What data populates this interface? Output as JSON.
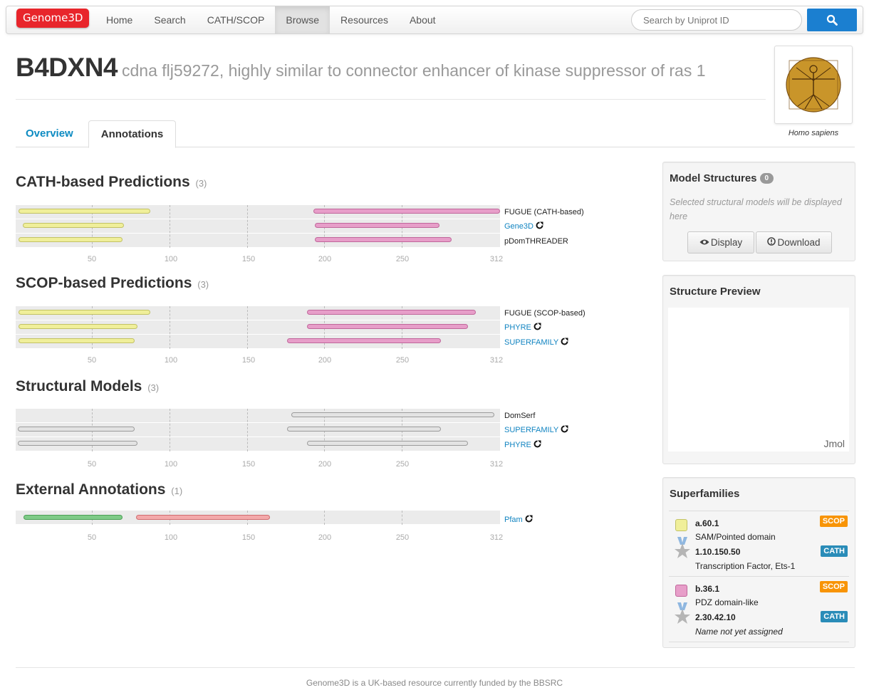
{
  "nav": {
    "brand": "Genome3D",
    "items": [
      "Home",
      "Search",
      "CATH/SCOP",
      "Browse",
      "Resources",
      "About"
    ],
    "active": "Browse",
    "search_placeholder": "Search by Uniprot ID"
  },
  "header": {
    "accession": "B4DXN4",
    "description": "cdna flj59272, highly similar to connector enhancer of kinase suppressor of ras 1",
    "species": "Homo sapiens"
  },
  "tabs": [
    "Overview",
    "Annotations"
  ],
  "axis_ticks": [
    "50",
    "100",
    "150",
    "200",
    "250",
    "312"
  ],
  "sections": {
    "cath": {
      "title": "CATH-based Predictions",
      "count": "(3)",
      "methods": [
        "FUGUE (CATH-based)",
        "Gene3D",
        "pDomTHREADER"
      ]
    },
    "scop": {
      "title": "SCOP-based Predictions",
      "count": "(3)",
      "methods": [
        "FUGUE (SCOP-based)",
        "PHYRE",
        "SUPERFAMILY"
      ]
    },
    "models": {
      "title": "Structural Models",
      "count": "(3)",
      "methods": [
        "DomSerf",
        "SUPERFAMILY",
        "PHYRE"
      ]
    },
    "external": {
      "title": "External Annotations",
      "count": "(1)",
      "methods": [
        "Pfam"
      ]
    }
  },
  "sidebar": {
    "model_structures": {
      "title": "Model Structures",
      "count": "0",
      "help": "Selected structural models will be displayed here",
      "display_label": "Display",
      "download_label": "Download"
    },
    "preview": {
      "title": "Structure Preview",
      "viewer": "Jmol"
    },
    "superfamilies": {
      "title": "Superfamilies",
      "items": [
        {
          "scop_code": "a.60.1",
          "scop_name": "SAM/Pointed domain",
          "cath_code": "1.10.150.50",
          "cath_name": "Transcription Factor, Ets-1",
          "color": "#f0ef9a"
        },
        {
          "scop_code": "b.36.1",
          "scop_name": "PDZ domain-like",
          "cath_code": "2.30.42.10",
          "cath_name": "Name not yet assigned",
          "color": "#e79ec9"
        }
      ],
      "scop_label": "SCOP",
      "cath_label": "CATH"
    }
  },
  "footer": "Genome3D is a UK-based resource currently funded by the BBSRC"
}
